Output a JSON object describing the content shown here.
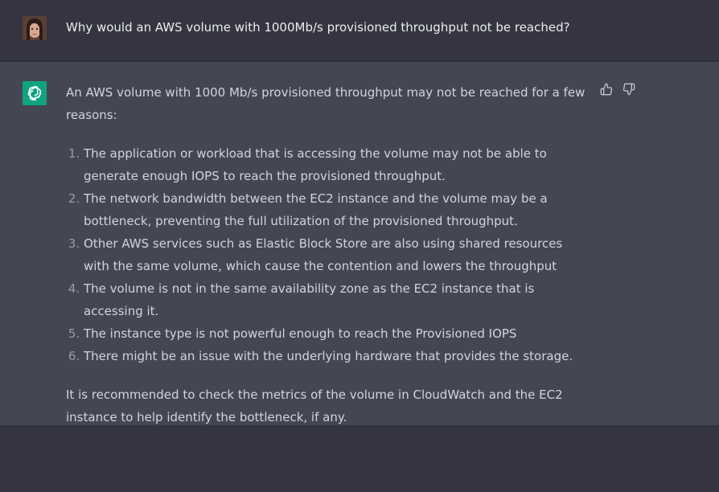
{
  "user_message": {
    "text": "Why would an AWS volume with 1000Mb/s provisioned throughput not be reached?",
    "avatar_icon": "user-avatar"
  },
  "assistant_message": {
    "logo_icon": "openai-logo-icon",
    "intro": "An AWS volume with 1000 Mb/s provisioned throughput may not be reached for a few reasons:",
    "items": [
      "The application or workload that is accessing the volume may not be able to generate enough IOPS to reach the provisioned throughput.",
      "The network bandwidth between the EC2 instance and the volume may be a bottleneck, preventing the full utilization of the provisioned throughput.",
      "Other AWS services such as Elastic Block Store are also using shared resources with the same volume, which cause the contention and lowers the throughput",
      "The volume is not in the same availability zone as the EC2 instance that is accessing it.",
      "The instance type is not powerful enough to reach the Provisioned IOPS",
      "There might be an issue with the underlying hardware that provides the storage."
    ],
    "conclusion": "It is recommended to check the metrics of the volume in CloudWatch and the EC2 instance to help identify the bottleneck, if any."
  },
  "feedback": {
    "thumbs_up_icon": "thumbs-up-icon",
    "thumbs_down_icon": "thumbs-down-icon"
  },
  "colors": {
    "background": "#343541",
    "assistant_background": "#444654",
    "text": "#d1d5db",
    "accent": "#10a37f"
  }
}
